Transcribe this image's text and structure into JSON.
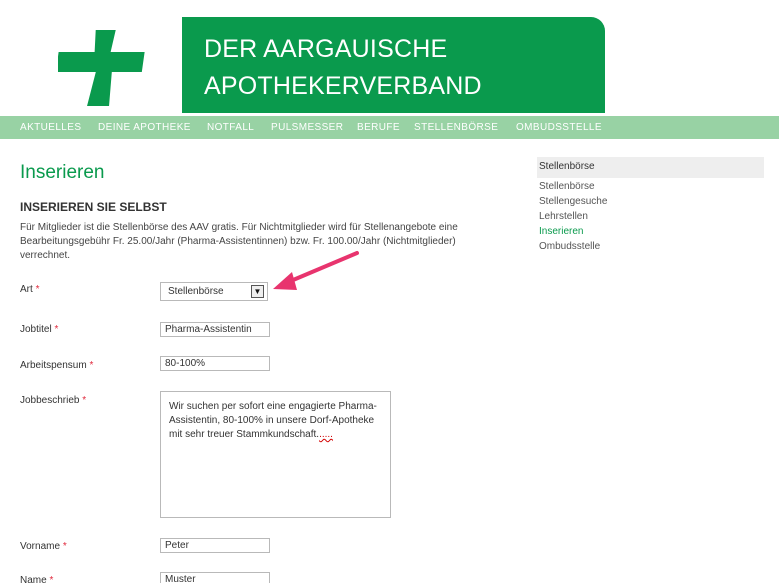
{
  "brand": {
    "line1": "DER AARGAUISCHE",
    "line2": "APOTHEKERVERBAND",
    "color": "#0a9a4d"
  },
  "logo": {
    "icon": "green-cross-icon"
  },
  "nav": {
    "items": [
      "AKTUELLES",
      "DEINE APOTHEKE",
      "NOTFALL",
      "PULSMESSER",
      "BERUFE",
      "STELLENBÖRSE",
      "OMBUDSSTELLE"
    ]
  },
  "main": {
    "title": "Inserieren",
    "section_title": "INSERIEREN SIE SELBST",
    "intro": "Für Mitglieder ist die Stellenbörse des AAV gratis. Für Nichtmitglieder wird für Stellenangebote eine Bearbeitungsgebühr Fr. 25.00/Jahr (Pharma-Assistentinnen) bzw. Fr. 100.00/Jahr (Nichtmitglieder) verrechnet."
  },
  "form": {
    "required_mark": "*",
    "art": {
      "label": "Art",
      "value": "Stellenbörse"
    },
    "jobtitel": {
      "label": "Jobtitel",
      "value": "Pharma-Assistentin"
    },
    "arbeitspensum": {
      "label": "Arbeitspensum",
      "value": "80-100%"
    },
    "jobbeschrieb": {
      "label": "Jobbeschrieb",
      "value": "Wir suchen per sofort eine engagierte Pharma-Assistentin, 80-100% in unsere Dorf-Apotheke mit sehr treuer Stammkundschaft.",
      "tail": "....."
    },
    "vorname": {
      "label": "Vorname",
      "value": "Peter"
    },
    "name": {
      "label": "Name",
      "value": "Muster"
    }
  },
  "sidebar": {
    "heading": "Stellenbörse",
    "links": [
      "Stellenbörse",
      "Stellengesuche",
      "Lehrstellen",
      "Inserieren",
      "Ombudsstelle"
    ],
    "active": "Inserieren"
  },
  "colors": {
    "accent": "#0a9a4d",
    "nav_bg": "#98d2a4",
    "required": "#e0283b",
    "annotation_arrow": "#e8346e"
  }
}
